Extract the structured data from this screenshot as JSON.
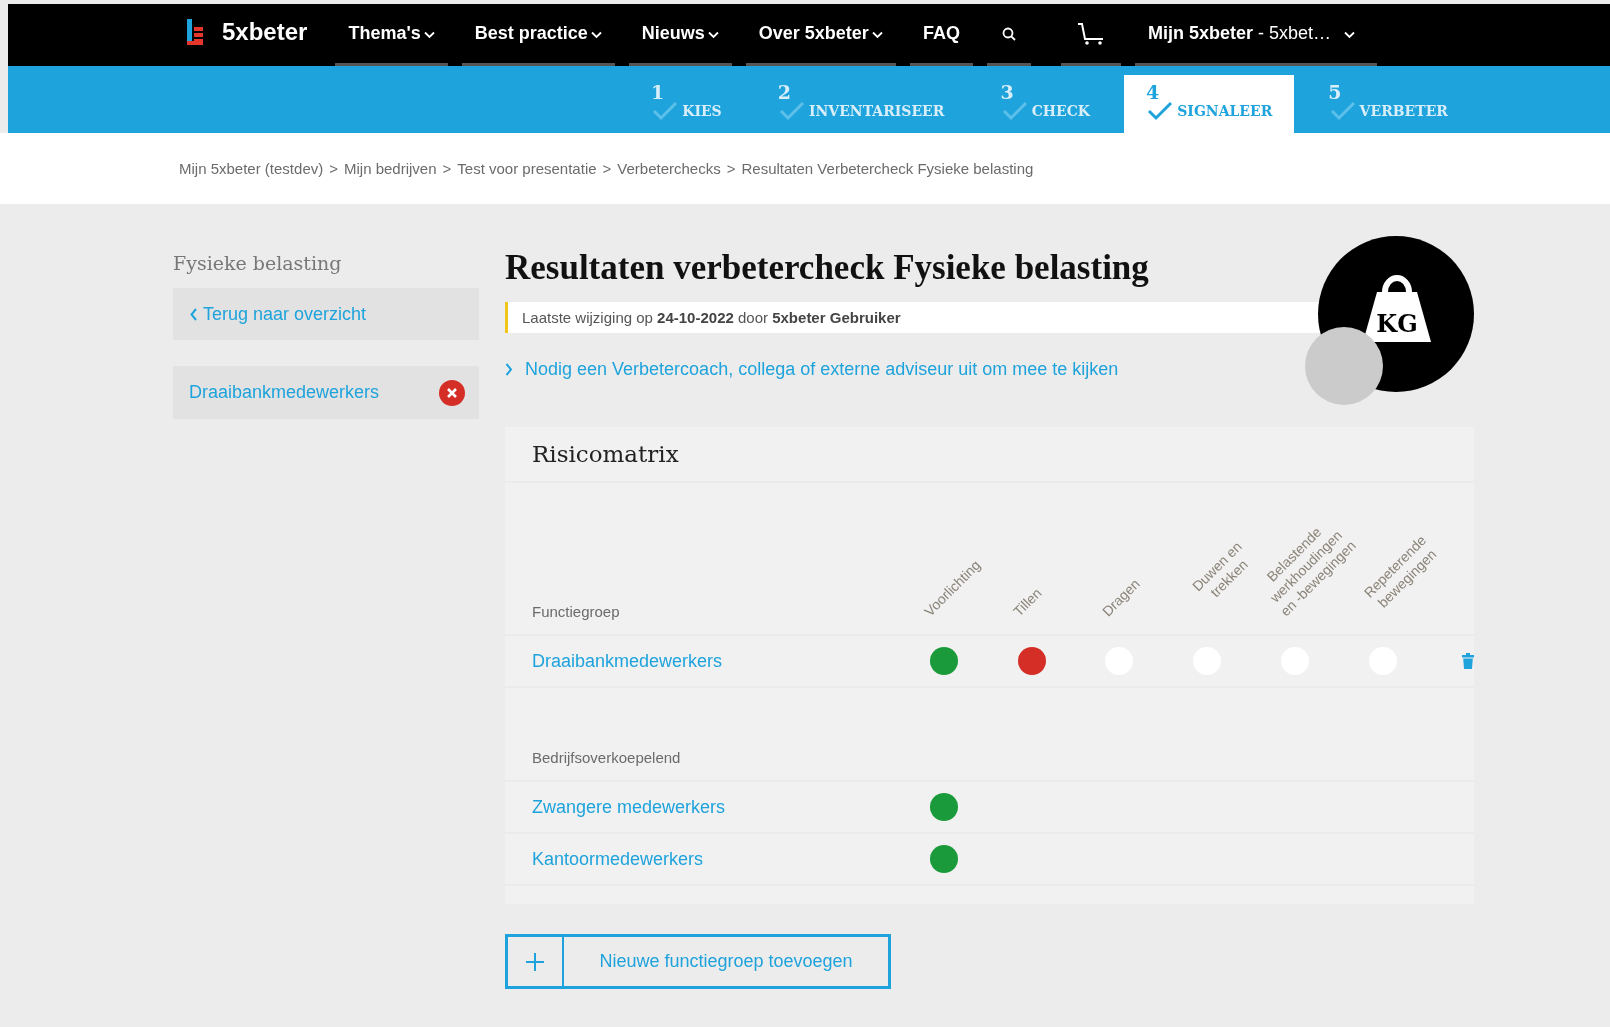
{
  "header": {
    "logo": "5xbeter",
    "nav": [
      {
        "label": "Thema's",
        "dropdown": true
      },
      {
        "label": "Best practice",
        "dropdown": true
      },
      {
        "label": "Nieuws",
        "dropdown": true
      },
      {
        "label": "Over 5xbeter",
        "dropdown": true
      },
      {
        "label": "FAQ",
        "dropdown": false
      }
    ],
    "account": {
      "label": "**Mijn 5xbeter** - 5xbet…",
      "dropdown": true
    }
  },
  "steps": [
    {
      "number": "1",
      "label": "KIES",
      "selected": false
    },
    {
      "number": "2",
      "label": "INVENTARISEER",
      "selected": false
    },
    {
      "number": "3",
      "label": "CHECK",
      "selected": false
    },
    {
      "number": "4",
      "label": "SIGNALEER",
      "selected": true
    },
    {
      "number": "5",
      "label": "VERBETER",
      "selected": false
    }
  ],
  "breadcrumb": {
    "separator": ">",
    "items": [
      "Mijn 5xbeter (testdev)",
      "Mijn bedrijven",
      "Test voor presentatie",
      "Verbeterchecks",
      "Resultaten Verbetercheck Fysieke belasting"
    ]
  },
  "sidebar": {
    "title": "Fysieke belasting",
    "back_link": "Terug naar overzicht",
    "items": [
      {
        "label": "Draaibankmedewerkers"
      }
    ]
  },
  "page": {
    "title": "Resultaten verbetercheck Fysieke belasting",
    "last_change": "Laatste wijziging op **24-10-2022** door **5xbeter Gebruiker**",
    "invite_link": "Nodig een Verbetercoach, collega of externe adviseur uit om mee te kijken",
    "badge_label": "KG"
  },
  "matrix": {
    "title": "Risicomatrix",
    "columns": [
      "Voorlichting",
      "Tillen",
      "Dragen",
      "Duwen en trekken",
      "Belastende werkhoudingen en -bewegingen",
      "Repeterende bewegingen"
    ],
    "sections": [
      {
        "heading": "Functiegroep",
        "rows": [
          {
            "name": "Draaibankmedewerkers",
            "deletable": true,
            "cells": [
              {
                "color": "#1a9a3a"
              },
              {
                "color": "#d42e26"
              },
              {
                "color": "#ffffff"
              },
              {
                "color": "#ffffff"
              },
              {
                "color": "#ffffff"
              },
              {
                "color": "#ffffff"
              }
            ]
          }
        ]
      },
      {
        "heading": "Bedrijfsoverkoepelend",
        "rows": [
          {
            "name": "Zwangere medewerkers",
            "deletable": false,
            "cells": [
              {
                "color": "#1a9a3a"
              }
            ]
          },
          {
            "name": "Kantoormedewerkers",
            "deletable": false,
            "cells": [
              {
                "color": "#1a9a3a"
              }
            ]
          }
        ]
      }
    ]
  },
  "add_button": {
    "label": "Nieuwe functiegroep toevoegen"
  }
}
